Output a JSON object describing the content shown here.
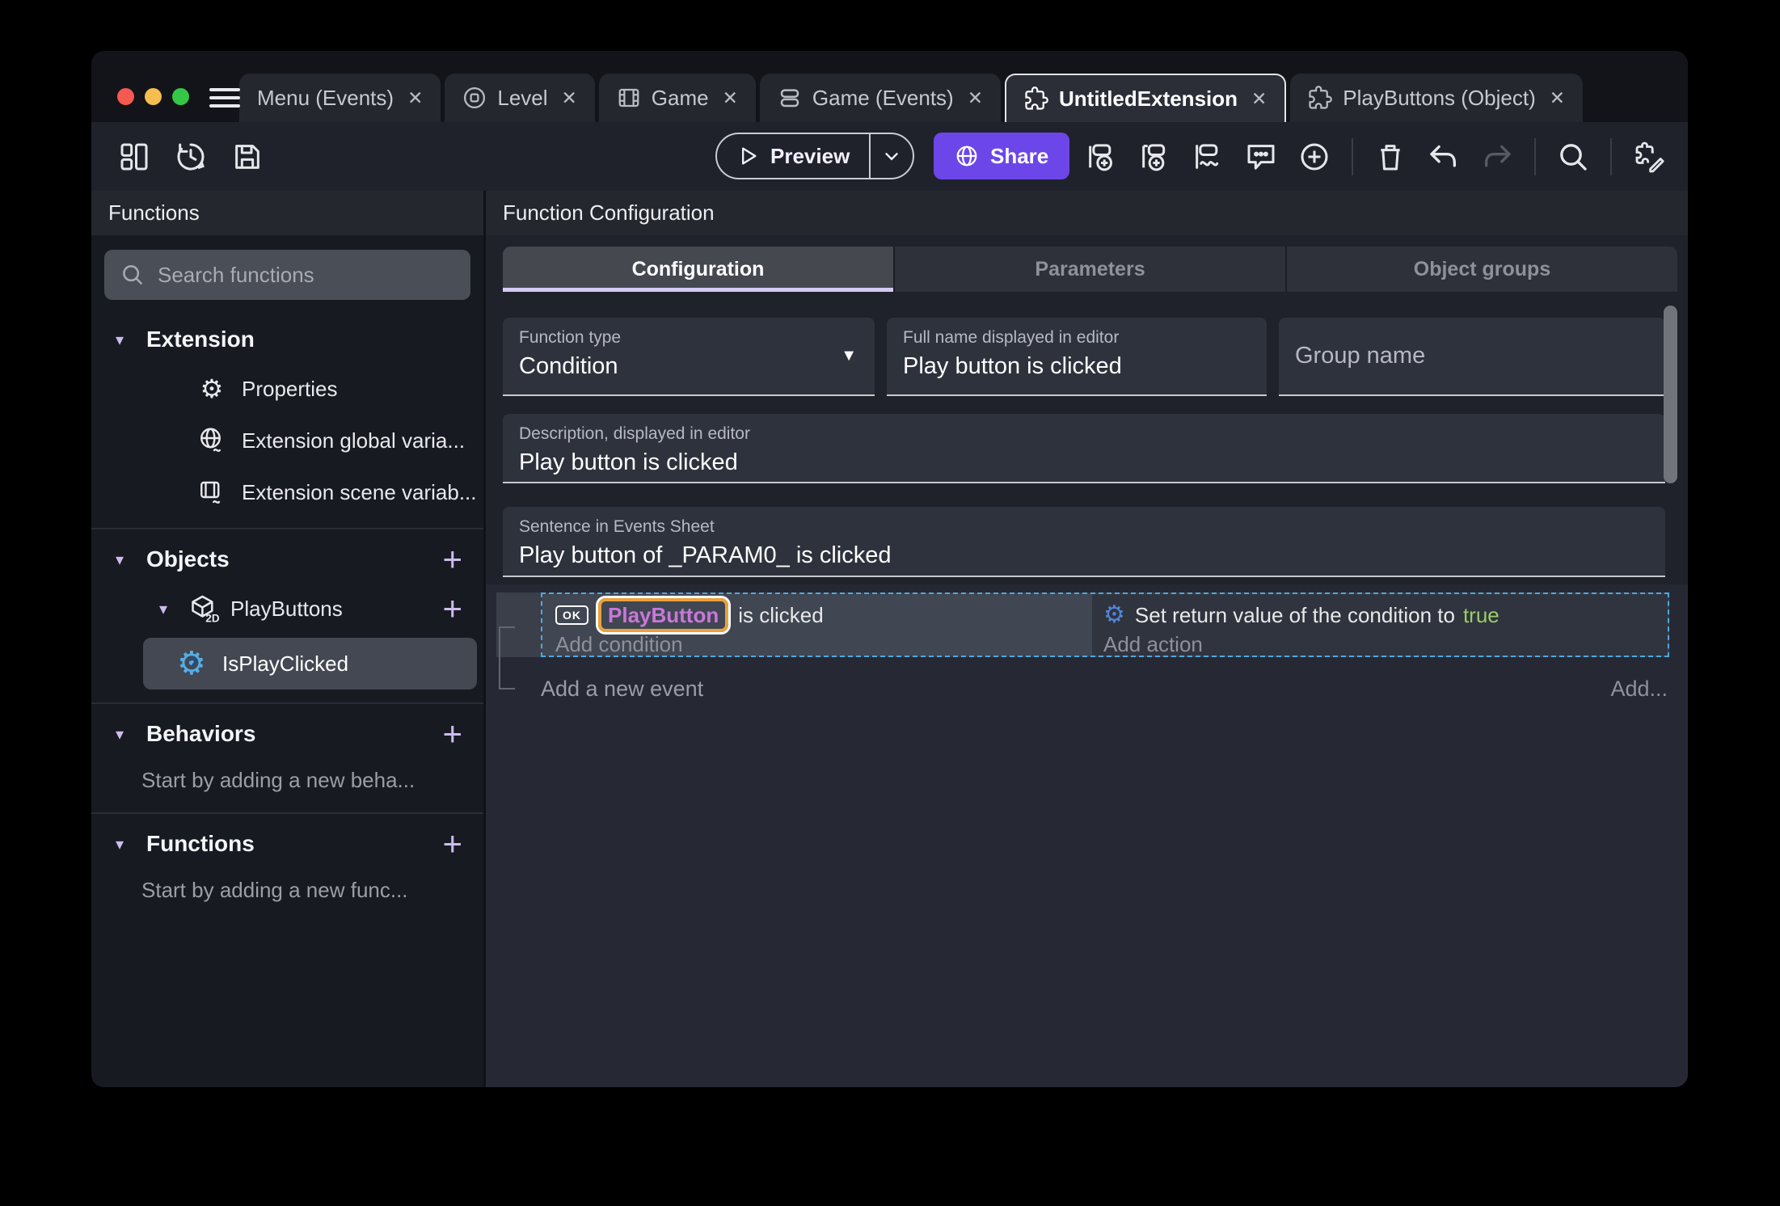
{
  "colors": {
    "accent_purple": "#6C46E8",
    "lavender_underline": "#D5CBF4",
    "object_name_purple": "#C878D8",
    "object_highlight_orange": "#E8A33D",
    "true_green": "#9CCC65",
    "selection_dashed_blue": "#4FA8E0"
  },
  "icons": {
    "tab_close": "✕",
    "section_caret": "▾",
    "add_plus": "+",
    "function_type_caret": "▼",
    "gear_glyph": "⚙",
    "question_glyph": "?",
    "cube_2d": "2D",
    "names": [
      "project-manager-icon",
      "history-icon",
      "save-icon",
      "play-icon",
      "chevron-down-icon",
      "globe-icon",
      "add-event-icon",
      "add-subevent-icon",
      "add-other-events-icon",
      "comment-icon",
      "circle-plus-icon",
      "trash-icon",
      "undo-icon",
      "redo-icon",
      "search-icon",
      "edit-extension-icon",
      "scene-icon",
      "film-icon",
      "events-icon",
      "puzzle-icon",
      "magnifier-icon",
      "gear-icon",
      "globe-variables-icon",
      "scene-variables-icon",
      "cube-2d-icon",
      "function-question-icon",
      "ok-badge-icon",
      "gear-action-icon"
    ]
  },
  "tabbar": {
    "tabs": [
      {
        "label": "Menu (Events)"
      },
      {
        "label": "Level"
      },
      {
        "label": "Game"
      },
      {
        "label": "Game (Events)"
      },
      {
        "label": "UntitledExtension"
      },
      {
        "label": "PlayButtons (Object)"
      }
    ]
  },
  "toolbar": {
    "preview_label": "Preview",
    "share_label": "Share"
  },
  "sidebar": {
    "title": "Functions",
    "search_placeholder": "Search functions",
    "sections": {
      "extension": {
        "label": "Extension",
        "items": [
          {
            "label": "Properties"
          },
          {
            "label": "Extension global varia..."
          },
          {
            "label": "Extension scene variab..."
          }
        ]
      },
      "objects": {
        "label": "Objects",
        "object": {
          "label": "PlayButtons"
        },
        "selected_function": {
          "label": "IsPlayClicked"
        }
      },
      "behaviors": {
        "label": "Behaviors",
        "empty_hint": "Start by adding a new beha..."
      },
      "functions": {
        "label": "Functions",
        "empty_hint": "Start by adding a new func..."
      }
    }
  },
  "main": {
    "title": "Function Configuration",
    "tabs": [
      {
        "label": "Configuration"
      },
      {
        "label": "Parameters"
      },
      {
        "label": "Object groups"
      }
    ],
    "fields": {
      "function_type": {
        "label": "Function type",
        "value": "Condition"
      },
      "full_name": {
        "label": "Full name displayed in editor",
        "value": "Play button is clicked"
      },
      "group_name": {
        "placeholder": "Group name"
      },
      "description": {
        "label": "Description, displayed in editor",
        "value": "Play button is clicked"
      },
      "sentence": {
        "label": "Sentence in Events Sheet",
        "value": "Play button of _PARAM0_ is clicked"
      }
    },
    "events": {
      "event": {
        "condition": {
          "ok_badge": "OK",
          "object_name": "PlayButton",
          "text_after": "is clicked",
          "add_label": "Add condition"
        },
        "action": {
          "text_before": "Set return value of the condition to",
          "value": "true",
          "add_label": "Add action"
        }
      },
      "add_event_label": "Add a new event",
      "add_more_label": "Add..."
    }
  }
}
